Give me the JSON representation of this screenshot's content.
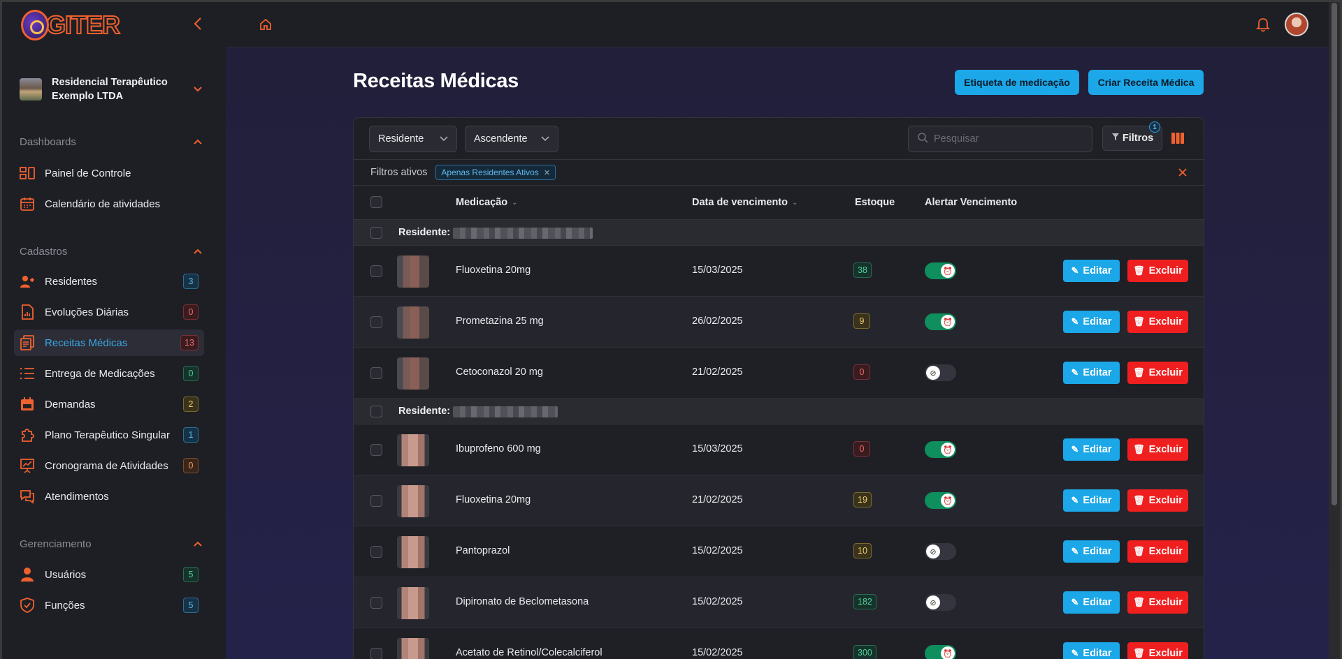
{
  "app": {
    "logo_text": "GITER"
  },
  "sidebar": {
    "org_name": "Residencial Terapêutico Exemplo LTDA",
    "sections": [
      {
        "title": "Dashboards"
      },
      {
        "title": "Cadastros"
      },
      {
        "title": "Gerenciamento"
      }
    ],
    "items": [
      {
        "label": "Painel de Controle",
        "badge": ""
      },
      {
        "label": "Calendário de atividades",
        "badge": ""
      },
      {
        "label": "Residentes",
        "badge": "3"
      },
      {
        "label": "Evoluções Diárias",
        "badge": "0"
      },
      {
        "label": "Receitas Médicas",
        "badge": "13"
      },
      {
        "label": "Entrega de Medicações",
        "badge": "0"
      },
      {
        "label": "Demandas",
        "badge": "2"
      },
      {
        "label": "Plano Terapêutico Singular",
        "badge": "1"
      },
      {
        "label": "Cronograma de Atividades",
        "badge": "0"
      },
      {
        "label": "Atendimentos",
        "badge": ""
      },
      {
        "label": "Usuários",
        "badge": "5"
      },
      {
        "label": "Funções",
        "badge": "5"
      }
    ]
  },
  "page": {
    "title": "Receitas Médicas",
    "btn_etiqueta": "Etiqueta de medicação",
    "btn_criar": "Criar Receita Médica"
  },
  "toolbar": {
    "group_by": "Residente",
    "order": "Ascendente",
    "search_placeholder": "Pesquisar",
    "filters_label": "Filtros",
    "filters_count": "1"
  },
  "active_filters": {
    "label": "Filtros ativos",
    "chip": "Apenas Residentes Ativos"
  },
  "table": {
    "headers": {
      "medication": "Medicação",
      "expiry": "Data de vencimento",
      "stock": "Estoque",
      "alert": "Alertar Vencimento"
    },
    "group_label": "Residente:",
    "edit_label": "Editar",
    "delete_label": "Excluir",
    "rows": [
      {
        "medication": "Fluoxetina 20mg",
        "expiry": "15/03/2025",
        "stock": "38",
        "alert": true
      },
      {
        "medication": "Prometazina 25 mg",
        "expiry": "26/02/2025",
        "stock": "9",
        "alert": true
      },
      {
        "medication": "Cetoconazol 20 mg",
        "expiry": "21/02/2025",
        "stock": "0",
        "alert": false
      },
      {
        "medication": "Ibuprofeno 600 mg",
        "expiry": "15/03/2025",
        "stock": "0",
        "alert": true
      },
      {
        "medication": "Fluoxetina 20mg",
        "expiry": "21/02/2025",
        "stock": "19",
        "alert": true
      },
      {
        "medication": "Pantoprazol",
        "expiry": "15/02/2025",
        "stock": "10",
        "alert": false
      },
      {
        "medication": "Dipironato de Beclometasona",
        "expiry": "15/02/2025",
        "stock": "182",
        "alert": false
      },
      {
        "medication": "Acetato de Retinol/Colecalciferol",
        "expiry": "15/02/2025",
        "stock": "300",
        "alert": true
      }
    ]
  },
  "colors": {
    "accent": "#f0612f",
    "primary_button": "#1ba7e8",
    "danger_button": "#f01f1f",
    "toggle_on": "#0f8f5d"
  }
}
